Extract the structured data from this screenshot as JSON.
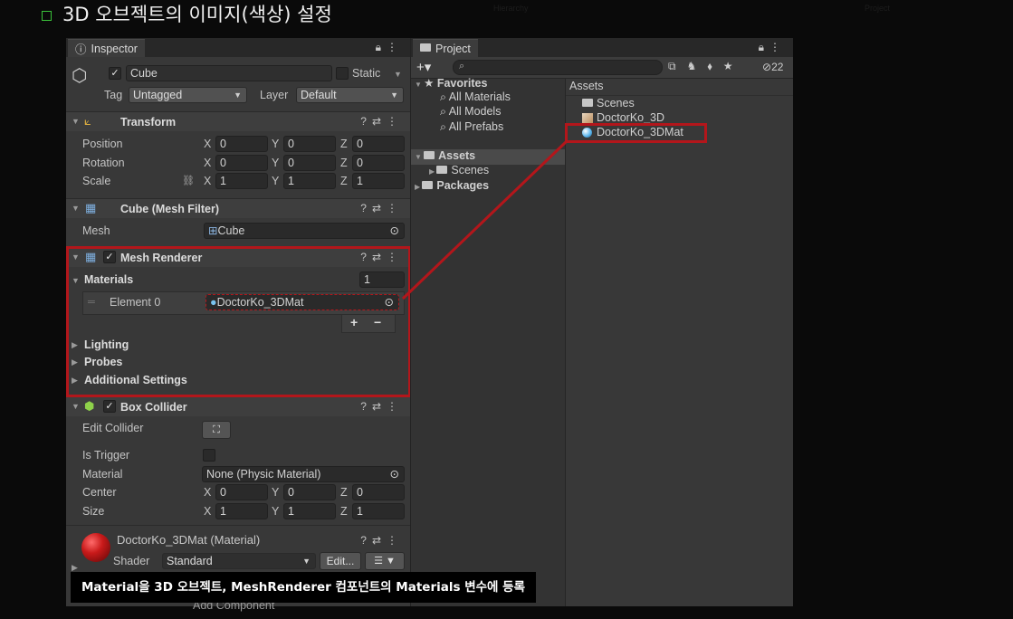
{
  "slide_title": "3D 오브젝트의 이미지(색상) 설정",
  "caption": "Material을 3D 오브젝트, MeshRenderer 컴포넌트의 Materials 변수에 등록",
  "inspector": {
    "tab": "Inspector",
    "object_name": "Cube",
    "static_label": "Static",
    "tag_label": "Tag",
    "tag_value": "Untagged",
    "layer_label": "Layer",
    "layer_value": "Default",
    "transform": {
      "title": "Transform",
      "rows": [
        {
          "label": "Position",
          "x": "0",
          "y": "0",
          "z": "0"
        },
        {
          "label": "Rotation",
          "x": "0",
          "y": "0",
          "z": "0"
        },
        {
          "label": "Scale",
          "x": "1",
          "y": "1",
          "z": "1"
        }
      ]
    },
    "mesh_filter": {
      "title": "Cube (Mesh Filter)",
      "mesh_label": "Mesh",
      "mesh_value": "Cube"
    },
    "mesh_renderer": {
      "title": "Mesh Renderer",
      "materials_label": "Materials",
      "materials_count": "1",
      "element_label": "Element 0",
      "element_value": "DoctorKo_3DMat",
      "plus": "+",
      "minus": "−",
      "lighting": "Lighting",
      "probes": "Probes",
      "additional": "Additional Settings"
    },
    "box_collider": {
      "title": "Box Collider",
      "edit_collider": "Edit Collider",
      "is_trigger": "Is Trigger",
      "material_label": "Material",
      "material_value": "None (Physic Material)",
      "center_label": "Center",
      "center": {
        "x": "0",
        "y": "0",
        "z": "0"
      },
      "size_label": "Size",
      "size": {
        "x": "1",
        "y": "1",
        "z": "1"
      }
    },
    "material": {
      "title": "DoctorKo_3DMat (Material)",
      "shader_label": "Shader",
      "shader_value": "Standard",
      "edit_label": "Edit...",
      "add_component": "Add Component"
    }
  },
  "project": {
    "tab": "Project",
    "hidden_count": "22",
    "favorites": {
      "title": "Favorites",
      "items": [
        "All Materials",
        "All Models",
        "All Prefabs"
      ]
    },
    "tree": {
      "assets": "Assets",
      "scenes": "Scenes",
      "packages": "Packages"
    },
    "assets_header": "Assets",
    "assets_items": [
      "Scenes",
      "DoctorKo_3D",
      "DoctorKo_3DMat"
    ]
  },
  "colors": {
    "highlight": "#b3161b",
    "panel": "#383838",
    "accent": "#3ac23a"
  }
}
